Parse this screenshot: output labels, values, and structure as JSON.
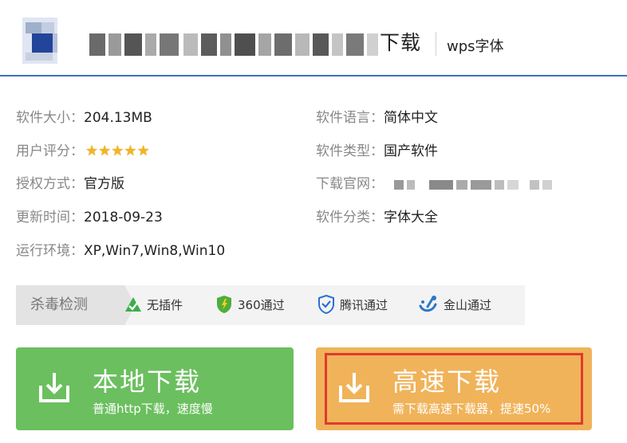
{
  "header": {
    "title_suffix": "下载",
    "tag": "wps字体"
  },
  "info": {
    "size_label": "软件大小：",
    "size_value": "204.13MB",
    "rating_label": "用户评分：",
    "rating_stars": 5,
    "license_label": "授权方式：",
    "license_value": "官方版",
    "updated_label": "更新时间：",
    "updated_value": "2018-09-23",
    "env_label": "运行环境：",
    "env_value": "XP,Win7,Win8,Win10",
    "language_label": "软件语言：",
    "language_value": "简体中文",
    "type_label": "软件类型：",
    "type_value": "国产软件",
    "official_label": "下载官网：",
    "category_label": "软件分类：",
    "category_value": "字体大全"
  },
  "antivirus": {
    "label": "杀毒检测",
    "items": [
      {
        "label": "无插件",
        "icon": "green-check-triangle-icon"
      },
      {
        "label": "360通过",
        "icon": "360-shield-icon"
      },
      {
        "label": "腾讯通过",
        "icon": "tencent-shield-icon"
      },
      {
        "label": "金山通过",
        "icon": "kingsoft-icon"
      }
    ]
  },
  "download": {
    "local_title": "本地下载",
    "local_sub": "普通http下载，速度慢",
    "fast_title": "高速下载",
    "fast_sub": "需下载高速下载器，提速50%"
  },
  "colors": {
    "accent_blue": "#3a73c4",
    "local_green": "#6bbf5f",
    "fast_orange": "#f0b35a",
    "highlight_red": "#e03a2e",
    "star_gold": "#f2b520"
  }
}
